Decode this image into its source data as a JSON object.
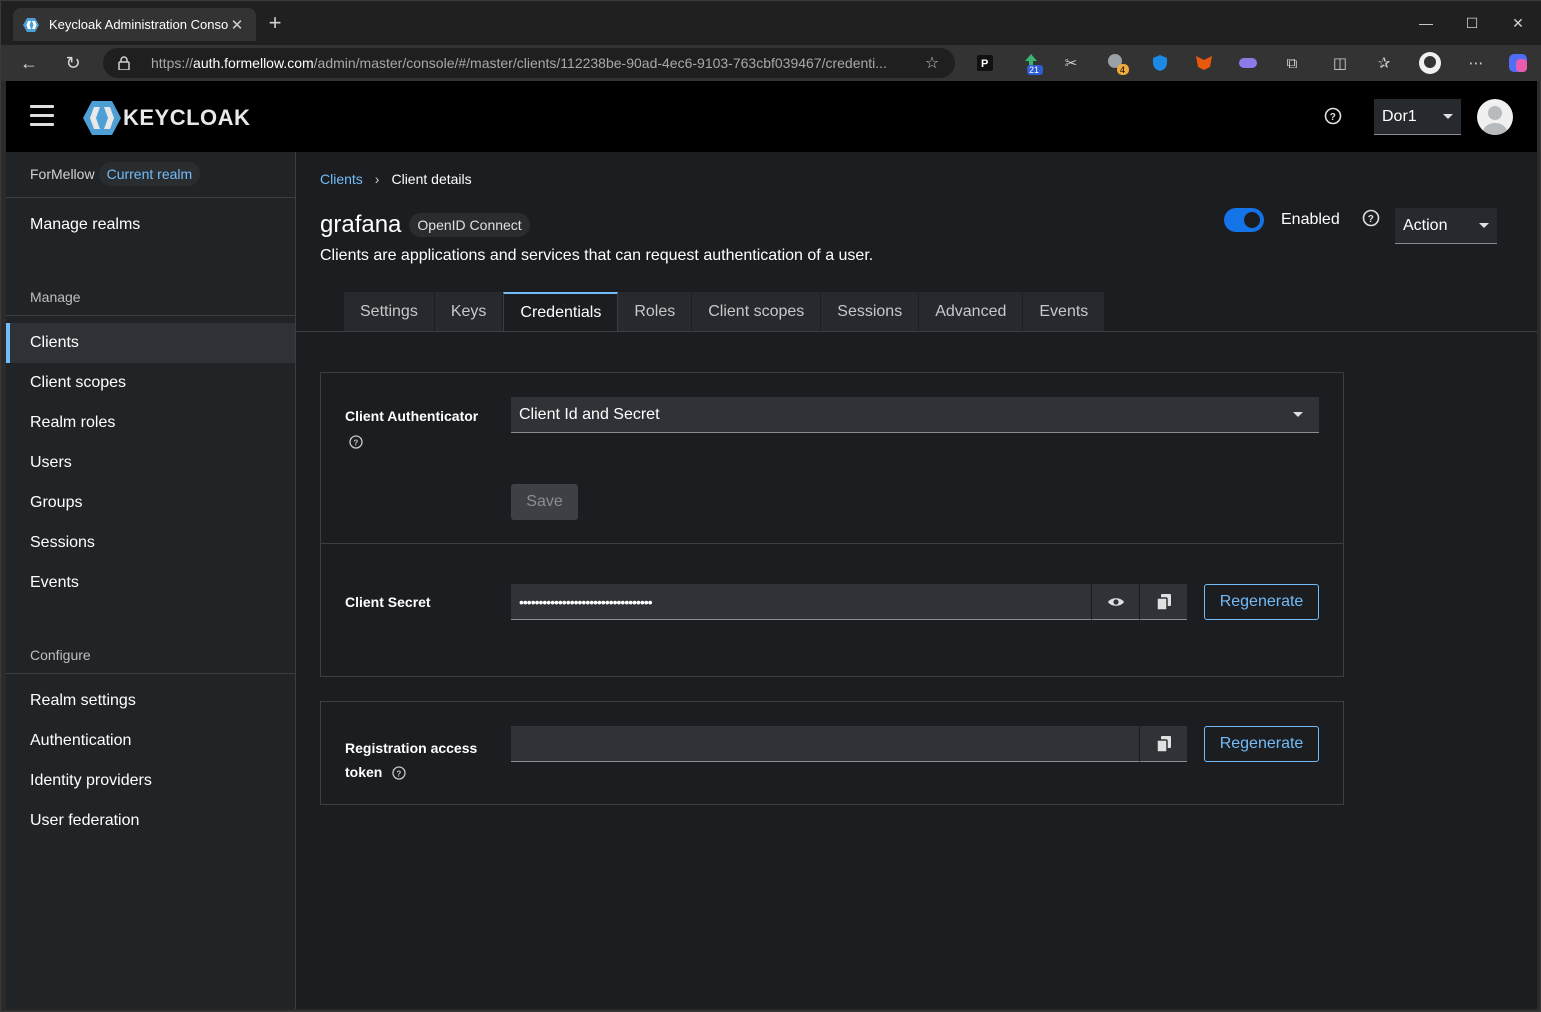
{
  "browser": {
    "tab_title": "Keycloak Administration Console",
    "url_prefix": "https://",
    "url_host": "auth.formellow.com",
    "url_path": "/admin/master/console/#/master/clients/112238be-90ad-4ec6-9103-763cbf039467/credenti...",
    "extension_badges": [
      "21",
      "4"
    ]
  },
  "header": {
    "brand": "KEYCLOAK",
    "realm_selector": "Dor1"
  },
  "sidebar": {
    "realm_name": "ForMellow",
    "realm_badge": "Current realm",
    "manage_realms": "Manage realms",
    "manage_group": "Manage",
    "manage_items": [
      "Clients",
      "Client scopes",
      "Realm roles",
      "Users",
      "Groups",
      "Sessions",
      "Events"
    ],
    "configure_group": "Configure",
    "configure_items": [
      "Realm settings",
      "Authentication",
      "Identity providers",
      "User federation"
    ]
  },
  "main": {
    "breadcrumb_root": "Clients",
    "breadcrumb_current": "Client details",
    "title": "grafana",
    "protocol_badge": "OpenID Connect",
    "description": "Clients are applications and services that can request authentication of a user.",
    "enabled_label": "Enabled",
    "action_label": "Action",
    "tabs": [
      "Settings",
      "Keys",
      "Credentials",
      "Roles",
      "Client scopes",
      "Sessions",
      "Advanced",
      "Events"
    ],
    "active_tab": "Credentials"
  },
  "credentials": {
    "authenticator_label": "Client Authenticator",
    "authenticator_value": "Client Id and Secret",
    "save_label": "Save",
    "secret_label": "Client Secret",
    "secret_value": "••••••••••••••••••••••••••••••••••",
    "regenerate_label": "Regenerate",
    "registration_label_1": "Registration access",
    "registration_label_2": "token",
    "registration_value": "",
    "regenerate_label_2": "Regenerate"
  },
  "colors": {
    "accent": "#73bcf7",
    "toggle_on": "#1473e6",
    "masthead": "#000000"
  }
}
